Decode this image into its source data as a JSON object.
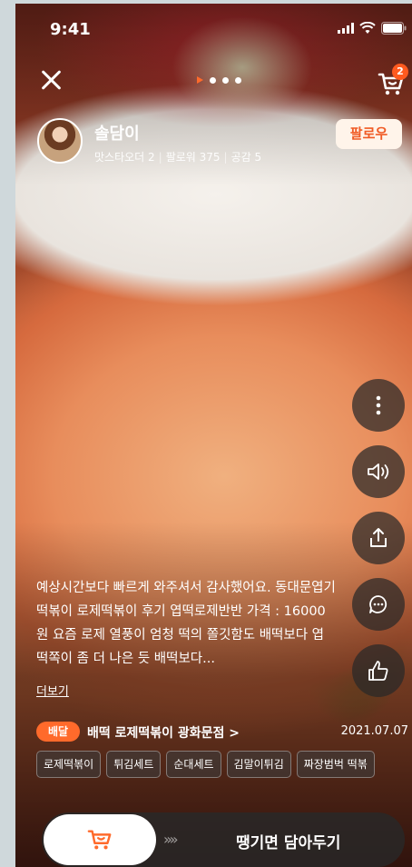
{
  "status_bar": {
    "time": "9:41"
  },
  "header": {
    "cart_count": "2",
    "page_indicator_total": 4
  },
  "user": {
    "name": "솔담이",
    "stat_grade": "맛스타오더 2",
    "stat_followers": "팔로워 375",
    "stat_likes": "공감 5",
    "follow_label": "팔로우"
  },
  "review": {
    "text": "예상시간보다 빠르게 와주셔서 감사했어요. 동대문엽기떡볶이 로제떡볶이 후기 엽떡로제반반 가격 : 16000원 요즘 로제 열풍이 엄청 떡의 쫄깃함도 배떡보다 엽떡쪽이 좀 더 나은 듯 배떡보다...",
    "more_label": "더보기"
  },
  "store": {
    "badge": "배달",
    "name": "배떡 로제떡볶이 광화문점 >",
    "date": "2021.07.07"
  },
  "tags": [
    "로제떡볶이",
    "튀김세트",
    "순대세트",
    "김말이튀김",
    "짜장범벅 떡볶"
  ],
  "side_actions": [
    "more-icon",
    "speaker-icon",
    "share-icon",
    "comment-icon",
    "like-icon"
  ],
  "bottom": {
    "arrows": "»»",
    "action_label": "땡기면 담아두기"
  },
  "colors": {
    "accent": "#ff6a2b",
    "follow_bg": "#fff4ea",
    "follow_text": "#f05a24"
  }
}
